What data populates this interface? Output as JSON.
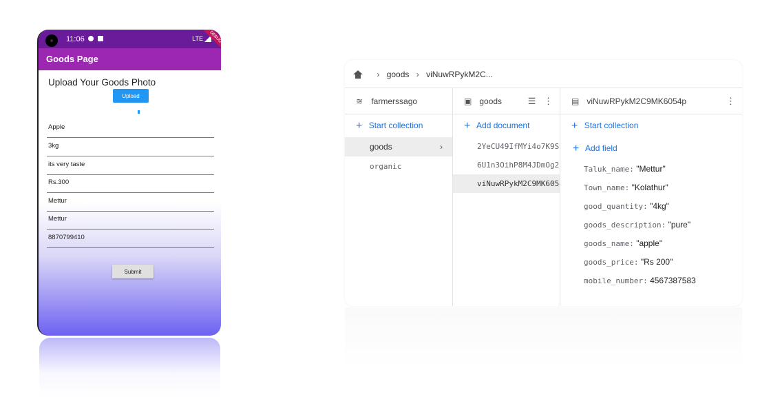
{
  "phone": {
    "time": "11:06",
    "network": "LTE",
    "debug_label": "DEBUG",
    "appbar_title": "Goods Page",
    "upload_title": "Upload Your Goods Photo",
    "upload_label": "Upload",
    "fields": [
      "Apple",
      "3kg",
      "its very taste",
      "Rs.300",
      "Mettur",
      "Mettur",
      "8870799410"
    ],
    "submit_label": "Submit"
  },
  "firestore": {
    "breadcrumb": [
      "goods",
      "viNuwRPykM2C..."
    ],
    "col1": {
      "title": "farmerssago",
      "add_label": "Start collection",
      "items": [
        "goods",
        "organic"
      ]
    },
    "col2": {
      "title": "goods",
      "add_label": "Add document",
      "docs": [
        "2YeCU49IfMYi4o7K9S",
        "6U1n3OihP8M4JDmOg2",
        "viNuwRPykM2C9MK6054"
      ]
    },
    "col3": {
      "title": "viNuwRPykM2C9MK6054p",
      "start_collection": "Start collection",
      "add_field": "Add field",
      "fields": [
        {
          "key": "Taluk_name:",
          "value": "\"Mettur\""
        },
        {
          "key": "Town_name:",
          "value": "\"Kolathur\""
        },
        {
          "key": "good_quantity:",
          "value": "\"4kg\""
        },
        {
          "key": "goods_description:",
          "value": "\"pure\""
        },
        {
          "key": "goods_name:",
          "value": "\"apple\""
        },
        {
          "key": "goods_price:",
          "value": "\"Rs 200\""
        },
        {
          "key": "mobile_number:",
          "value": "4567387583"
        }
      ]
    }
  }
}
